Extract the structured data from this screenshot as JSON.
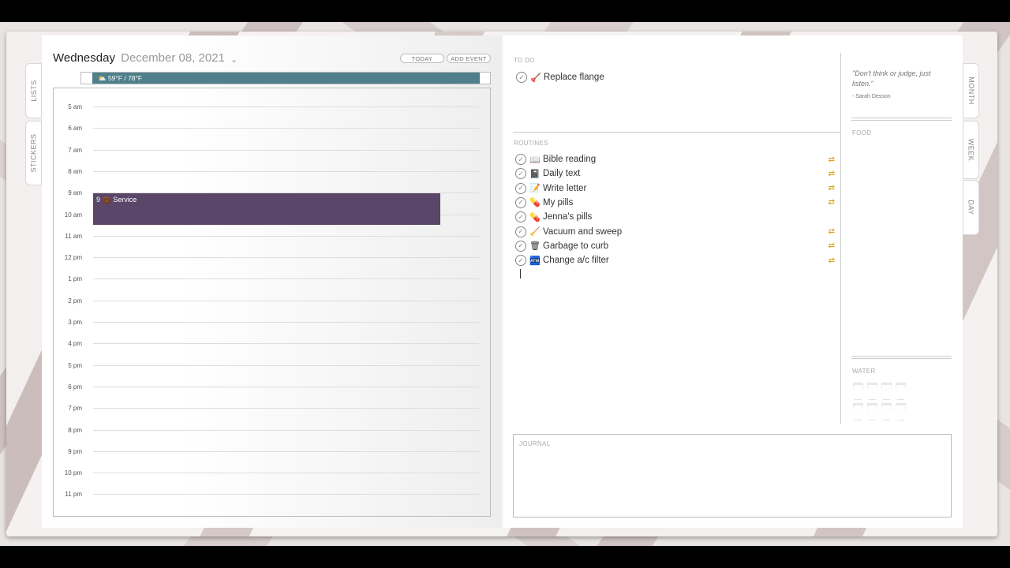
{
  "tabs_left": [
    "LISTS",
    "STICKERS"
  ],
  "tabs_right": [
    "MONTH",
    "WEEK",
    "DAY"
  ],
  "header": {
    "day": "Wednesday",
    "date": "December 08, 2021"
  },
  "buttons": {
    "today": "TODAY",
    "add_event": "ADD EVENT"
  },
  "weather": "⛅ 59°F / 78°F",
  "hours": [
    "5 am",
    "6 am",
    "7 am",
    "8 am",
    "9 am",
    "10 am",
    "11 am",
    "12 pm",
    "1 pm",
    "2 pm",
    "3 pm",
    "4 pm",
    "5 pm",
    "6 pm",
    "7 pm",
    "8 pm",
    "9 pm",
    "10 pm",
    "11 pm"
  ],
  "event": {
    "text": "9 💼 Service"
  },
  "todo": {
    "label": "TO DO",
    "items": [
      {
        "icon": "🪠",
        "text": "Replace flange"
      }
    ]
  },
  "routines": {
    "label": "ROUTINES",
    "items": [
      {
        "icon": "📖",
        "text": "Bible reading",
        "repeat": true
      },
      {
        "icon": "📓",
        "text": "Daily text",
        "repeat": true
      },
      {
        "icon": "📝",
        "text": "Write letter",
        "repeat": true
      },
      {
        "icon": "💊",
        "text": "My pills",
        "repeat": true
      },
      {
        "icon": "💊",
        "text": "Jenna's pills",
        "repeat": false
      },
      {
        "icon": "🧹",
        "text": "Vacuum and sweep",
        "repeat": true
      },
      {
        "icon": "🗑",
        "text": "Garbage to curb",
        "repeat": true
      },
      {
        "icon": "🏧",
        "text": "Change a/c filter",
        "repeat": true
      }
    ]
  },
  "quote": {
    "text": "\"Don't think or judge, just listen.\"",
    "author": "- Sarah Desson"
  },
  "food_label": "FOOD",
  "water_label": "WATER",
  "journal_label": "JOURNAL",
  "repeat_icon": "⇄"
}
